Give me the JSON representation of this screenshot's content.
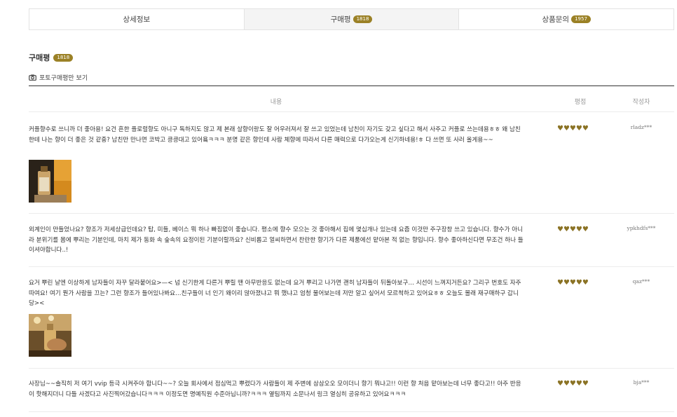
{
  "tabs": [
    {
      "label": "상세정보",
      "count": ""
    },
    {
      "label": "구매평",
      "count": "1818"
    },
    {
      "label": "상품문의",
      "count": "1957"
    }
  ],
  "section": {
    "title": "구매평",
    "count": "1818",
    "photo_only": "포토구매평만 보기"
  },
  "table_headers": {
    "content": "내용",
    "rating": "평점",
    "author": "작성자"
  },
  "stars": "♥♥♥♥♥",
  "reviews": [
    {
      "text": "커플향수로 쓰니까 더 좋아용! 요건 흔한 플로럴향도 아니구 독하지도 않고 제 본래 살향이랑도 잘 어우러져서 잘 쓰고 있었는데 남친이 자기도 갖고 싶다고 해서 사주고 커플로 쓰는데용ㅎㅎ 왜 남친한테 나는 향이 더 좋은 것 같죵? 남친만 만나면 코박고 킁킁대고 있어욬ㅋㅋㅋ 분명 같은 향인데 사람 체향에 따라서 다른 매력으로 다가오는게 신기하네용!ㅎ 다 쓰면 또 사러 올게용~~",
      "author": "rladz***",
      "rating": 5
    },
    {
      "text": "외계인이 만들었나요? 향조가 저세상급인데요? 탑, 미들, 베이스 뭐 하나 빠짐없이 좋습니다. 평소에 향수 모으는 것 좋아해서 집에 몇십개나 있는데 요즘 이것만 주구장창 쓰고 있습니다. 향수가 아니라 분위기를 몸에 뿌리는 기분인데, 마치 제가 동화 속 숲속의 요정이된 기분이랄까요? 신비롭고 얼씨하면서 찬란한 향기가 다른 제품에선 맡아본 적 없는 향입니다. 향수 좋아하신다면 무조건 하나 들이셔야합니다..!",
      "author": "ypkhdfs***",
      "rating": 5
    },
    {
      "text": "요거 뿌린 날엔 이상하게 남자들이 자꾸 달라붙어요>—< 넘 신기한게 다른거 뿌릴 땐 아무반응도 없는데 요거 뿌리고 나가면 괜히 남자들이 뒤돌아보구… 시선이 느껴지거든요? 그리구 번호도 자주 따여요! 여기 뭔가 사람을 끄는? 그런 향조가 들어있나봐요…친구들이 너 인기 왜이리 많아졌냐고 뭐 했냐고 엄청 물어보는데 저만 알고 싶어서 모르척하고 있어요ㅎㅎ 오늘도 몰래 재구매하구 갑니당><",
      "author": "qaz***",
      "rating": 5
    },
    {
      "text": "사장님~~솔직히 저 여기 vvip 등극 시켜주야 합니다~~? 오늘 회사에서 점심먹고 뿌렸다가 사람들이 제 주변에 삼삼오오 모이더니 향기 뭐냐고!! 이런 향 처음 맡아보는데 너무 좋다고!! 아주 반응이 핫해지더니 다들 사겠다고 사진찍어갔습니다ㅋㅋㅋ 이정도면 명예직원 수준아닙니까?ㅋㅋㅋ 옆팀까지 소문나서 링크 열심히 공유하고 있어요ㅋㅋㅋ",
      "author": "bja***",
      "rating": 5
    }
  ],
  "colors": {
    "accent": "#9b8126",
    "heart": "#8b7325"
  }
}
